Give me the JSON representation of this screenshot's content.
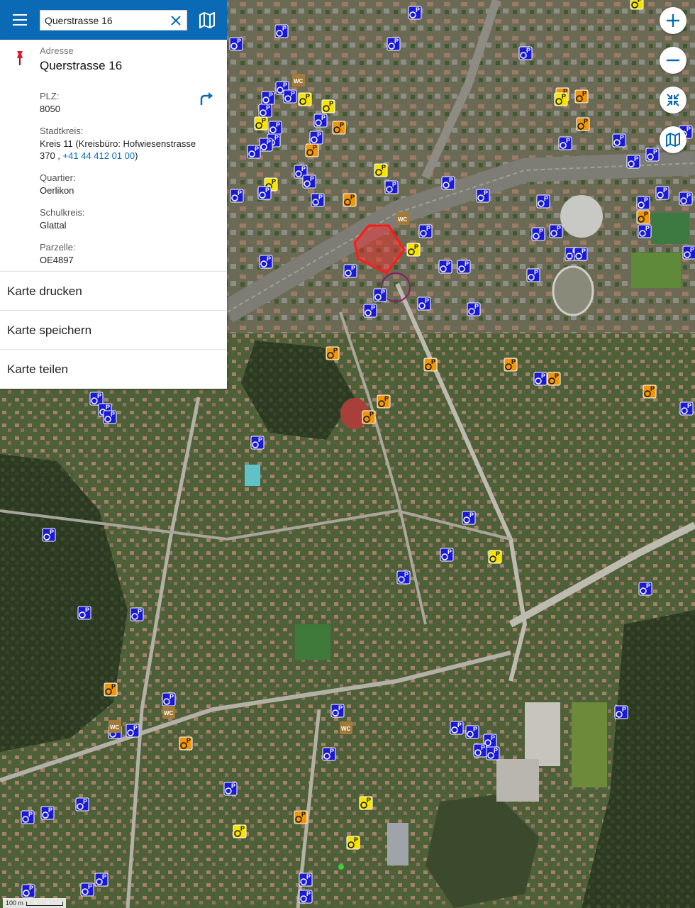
{
  "search": {
    "value": "Querstrasse 16"
  },
  "info": {
    "address_label": "Adresse",
    "address_value": "Querstrasse 16",
    "plz_label": "PLZ:",
    "plz_value": "8050",
    "stadtkreis_label": "Stadtkreis:",
    "stadtkreis_line1": "Kreis 11 (Kreisbüro: Hofwiesenstrasse",
    "stadtkreis_line2_prefix": "370 ,",
    "stadtkreis_phone": "+41 44 412 01 00",
    "stadtkreis_line2_suffix": ")",
    "quartier_label": "Quartier:",
    "quartier_value": "Oerlikon",
    "schulkreis_label": "Schulkreis:",
    "schulkreis_value": "Glattal",
    "parzelle_label": "Parzelle:",
    "parzelle_value": "OE4897"
  },
  "actions": [
    {
      "label": "Karte drucken"
    },
    {
      "label": "Karte speichern"
    },
    {
      "label": "Karte teilen"
    }
  ],
  "map": {
    "scale_label": "100 m"
  },
  "colors": {
    "brand": "#0a6ab6",
    "parking_blue": "#1a1ad6",
    "parking_yellow": "#f5e400",
    "parking_orange": "#f0960a",
    "wc_brown": "#a27b3a",
    "selection_red": "#ff1a1a",
    "circle_purple": "#8a1a6a"
  },
  "icons": {
    "menu": "hamburger-icon",
    "clear": "close-icon",
    "map_switch": "map-icon",
    "pin": "pushpin-icon",
    "route": "route-arrow-icon",
    "zoom_in": "plus-icon",
    "zoom_out": "minus-icon",
    "fit": "collapse-icon",
    "layers": "map-icon",
    "parking_marker": "disabled-parking-icon",
    "wc_marker": "wc-icon"
  }
}
